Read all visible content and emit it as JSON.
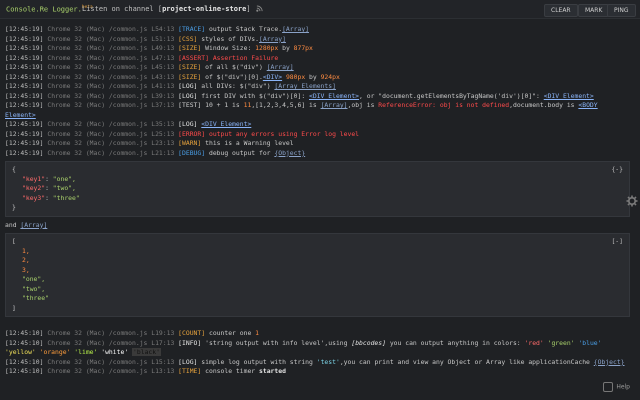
{
  "header": {
    "brand": "Console.Re Logger.",
    "brand_sup": "beta",
    "listen_prefix": "Listen on channel [",
    "channel": "project-online-store",
    "listen_suffix": "]",
    "buttons": {
      "clear": "CLEAR",
      "mark": "MARK",
      "ping": "PING"
    }
  },
  "log": [
    {
      "ts": "[12:45:19]",
      "file": "Chrome 32 (Mac) /common.js L54:13",
      "tag": "[TRACE]",
      "tagc": "trace",
      "msg": "output Stack Trace.",
      "link": "[Array]"
    },
    {
      "ts": "[12:45:19]",
      "file": "Chrome 32 (Mac) /common.js L51:13",
      "tag": "[CSS]",
      "tagc": "css",
      "msg": "styles of DIVs.",
      "link": "[Array]"
    },
    {
      "ts": "[12:45:19]",
      "file": "Chrome 32 (Mac) /common.js L49:13",
      "tag": "[SIZE]",
      "tagc": "size",
      "msg": "Window Size: ",
      "px1": "1280px",
      "mid": " by ",
      "px2": "877px"
    },
    {
      "ts": "[12:45:19]",
      "file": "Chrome 32 (Mac) /common.js L47:13",
      "tag": "[ASSERT]",
      "tagc": "assert",
      "msg": "Assertion Failure"
    },
    {
      "ts": "[12:45:19]",
      "file": "Chrome 32 (Mac) /common.js L45:13",
      "tag": "[SIZE]",
      "tagc": "size",
      "msg": "of all $(\"div\") ",
      "link": "[Array]"
    },
    {
      "ts": "[12:45:19]",
      "file": "Chrome 32 (Mac) /common.js L43:13",
      "tag": "[SIZE]",
      "tagc": "size",
      "msg": "of $(\"div\")[0].",
      "el": "<DIV>",
      "px1": " 980px",
      "mid": " by ",
      "px2": "924px"
    },
    {
      "ts": "[12:45:19]",
      "file": "Chrome 32 (Mac) /common.js L41:13",
      "tag": "[LOG]",
      "tagc": "log",
      "msg": "all DIVs: $(\"div\") ",
      "link": "[Array Elements]"
    }
  ],
  "log2": {
    "first_div": {
      "ts": "[12:45:19]",
      "file": "Chrome 32 (Mac) /common.js L39:13",
      "tag": "[LOG]",
      "msg1": "first DIV with $(\"div\")[0]: ",
      "el1": "<DIV Element>",
      "msg2": ", or \"document.getElementsByTagName('div')[0]\": ",
      "el2": "<DIV Element>"
    },
    "test": {
      "ts": "[12:45:19]",
      "file": "Chrome 32 (Mac) /common.js L37:13",
      "tag": "[TEST]",
      "msg1": "10 + 1 is ",
      "n": "11",
      "msg2": ",[1,2,3,4,5,6] is ",
      "link": "[Array]",
      "msg3": ",obj is ",
      "err": "ReferenceError: obj is not defined",
      "msg4": ",document.body is ",
      "el": "<BODY Element>"
    },
    "lines": [
      {
        "ts": "[12:45:19]",
        "file": "Chrome 32 (Mac) /common.js L35:13",
        "tag": "[LOG]",
        "tagc": "log",
        "msg": "",
        "el": "<DIV Element>"
      },
      {
        "ts": "[12:45:19]",
        "file": "Chrome 32 (Mac) /common.js L25:13",
        "tag": "[ERROR]",
        "tagc": "error",
        "msg": "output any errors using Error log level"
      },
      {
        "ts": "[12:45:19]",
        "file": "Chrome 32 (Mac) /common.js L23:13",
        "tag": "[WARN]",
        "tagc": "warn",
        "msg": "this is a Warning level"
      },
      {
        "ts": "[12:45:19]",
        "file": "Chrome 32 (Mac) /common.js L21:13",
        "tag": "[DEBUG]",
        "tagc": "debug",
        "msg": "debug output for ",
        "link": "{Object}"
      }
    ]
  },
  "object_block": {
    "toggle": "{-}",
    "open": "{",
    "close": "}",
    "entries": [
      {
        "key": "\"key1\"",
        "val": "\"one\","
      },
      {
        "key": "\"key2\"",
        "val": "\"two\","
      },
      {
        "key": "\"key3\"",
        "val": "\"three\""
      }
    ]
  },
  "and_line": {
    "text": "and ",
    "link": "[Array]"
  },
  "array_block": {
    "toggle": "[-]",
    "open": "[",
    "close": "]",
    "nums": [
      "1,",
      "2,",
      "3,"
    ],
    "strs": [
      "\"one\",",
      "\"two\",",
      "\"three\""
    ]
  },
  "tail": {
    "count": {
      "ts": "[12:45:10]",
      "file": "Chrome 32 (Mac) /common.js L19:13",
      "tag": "[COUNT]",
      "msg": "counter one ",
      "n": "1"
    },
    "info": {
      "ts": "[12:45:10]",
      "file": "Chrome 32 (Mac) /common.js L17:13",
      "tag": "[INFO]",
      "msg1": "'string output with info level'",
      "msg2": ",using ",
      "em": "[bbcodes]",
      "msg3": " you can output anything in colors: ",
      "colors": [
        "'red'",
        "'green'",
        "'blue'",
        "'yellow'",
        "'orange'",
        "'lime'",
        "'white'",
        "'black'"
      ]
    },
    "log": {
      "ts": "[12:45:10]",
      "file": "Chrome 32 (Mac) /common.js L15:13",
      "tag": "[LOG]",
      "msg1": "simple log output with string ",
      "str": "'test'",
      "msg2": ",you can print and view any Object or Array like applicationCache ",
      "link": "{Object}"
    },
    "time": {
      "ts": "[12:45:10]",
      "file": "Chrome 32 (Mac) /common.js L13:13",
      "tag": "[TIME]",
      "msg": "console timer ",
      "strong": "started"
    }
  },
  "help": "Help"
}
